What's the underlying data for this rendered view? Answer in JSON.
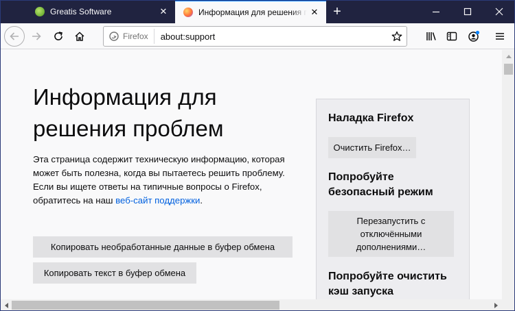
{
  "tabs": [
    {
      "title": "Greatis Software",
      "close_glyph": "✕"
    },
    {
      "title": "Информация для решения пр",
      "close_glyph": "✕"
    }
  ],
  "new_tab_glyph": "+",
  "window_controls": {
    "minimize": "—",
    "maximize": "☐",
    "close": "✕"
  },
  "urlbar": {
    "identity_label": "Firefox",
    "url": "about:support"
  },
  "page": {
    "title": "Информация для решения проблем",
    "description": "Эта страница содержит техническую информацию, которая может быть полезна, когда вы пытаетесь решить проблему. Если вы ищете ответы на типичные вопросы о Firefox, обратитесь на наш ",
    "support_link": "веб-сайт поддержки",
    "description_end": ".",
    "copy_raw_button": "Копировать необработанные данные в буфер обмена",
    "copy_text_button": "Копировать текст в буфер обмена"
  },
  "sidebar": {
    "refresh_heading": "Наладка Firefox",
    "refresh_button": "Очистить Firefox…",
    "safe_mode_heading": "Попробуйте безопасный режим",
    "safe_mode_button": "Перезапустить с отключёнными дополнениями…",
    "startup_cache_heading": "Попробуйте очистить кэш запуска"
  },
  "colors": {
    "titlebar": "#202340",
    "accent": "#0a84ff",
    "link": "#0060df"
  },
  "icons": [
    "back-arrow-icon",
    "forward-arrow-icon",
    "reload-icon",
    "home-icon",
    "firefox-icon",
    "star-icon",
    "library-icon",
    "sidebar-icon",
    "account-icon",
    "menu-icon"
  ]
}
